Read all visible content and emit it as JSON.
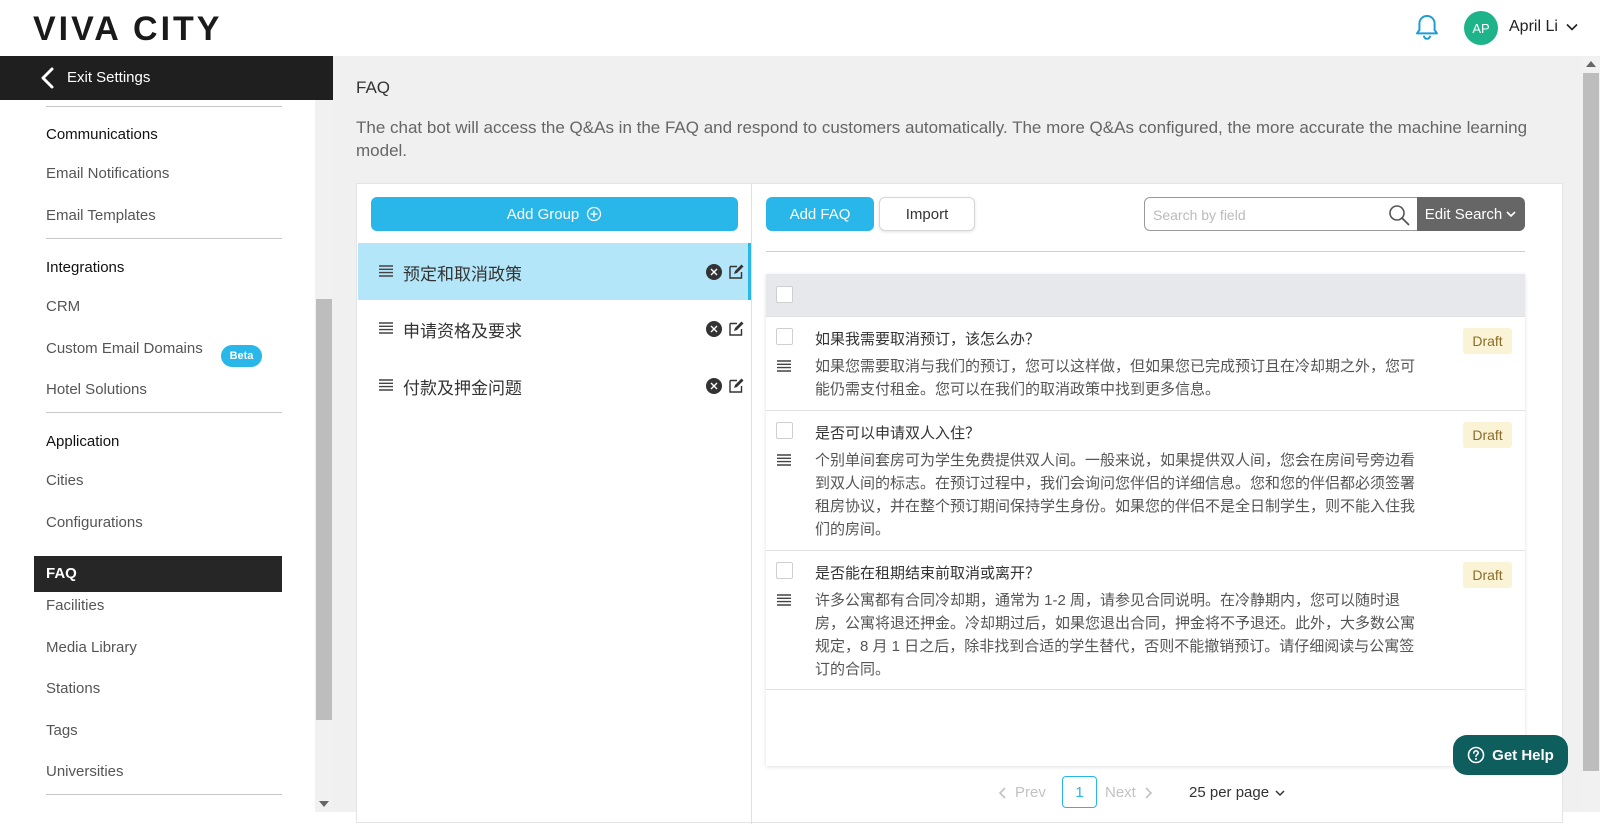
{
  "brand": {
    "logo_text": "VIVA CITY"
  },
  "user": {
    "initials": "AP",
    "name": "April Li",
    "avatar_color": "#1fb38a"
  },
  "sidebar": {
    "exit_label": "Exit Settings",
    "sections": [
      {
        "heading": "Communications",
        "items": [
          "Email Notifications",
          "Email Templates"
        ]
      },
      {
        "heading": "Integrations",
        "items": [
          "CRM",
          "Custom Email Domains",
          "Hotel Solutions"
        ],
        "badge": "Beta"
      },
      {
        "heading": "Application",
        "items": [
          "Cities",
          "Configurations",
          "FAQ",
          "Facilities",
          "Media Library",
          "Stations",
          "Tags",
          "Universities"
        ]
      }
    ],
    "active_item": "FAQ"
  },
  "page": {
    "title": "FAQ",
    "description": "The chat bot will access the Q&As in the FAQ and respond to customers automatically. The more Q&As configured, the more accurate the machine learning model."
  },
  "groups": {
    "add_label": "Add Group",
    "items": [
      {
        "label": "预定和取消政策",
        "active": true
      },
      {
        "label": "申请资格及要求",
        "active": false
      },
      {
        "label": "付款及押金问题",
        "active": false
      }
    ]
  },
  "faq": {
    "add_label": "Add FAQ",
    "import_label": "Import",
    "search_placeholder": "Search by field",
    "edit_search_label": "Edit Search",
    "items": [
      {
        "question": "如果我需要取消预订，该怎么办？",
        "answer": "如果您需要取消与我们的预订，您可以这样做，但如果您已完成预订且在冷却期之外，您可能仍需支付租金。您可以在我们的取消政策中找到更多信息。",
        "status": "Draft"
      },
      {
        "question": "是否可以申请双人入住？",
        "answer": "个别单间套房可为学生免费提供双人间。一般来说，如果提供双人间，您会在房间号旁边看到双人间的标志。在预订过程中，我们会询问您伴侣的详细信息。您和您的伴侣都必须签署租房协议，并在整个预订期间保持学生身份。如果您的伴侣不是全日制学生，则不能入住我们的房间。",
        "status": "Draft"
      },
      {
        "question": "是否能在租期结束前取消或离开？",
        "answer": "许多公寓都有合同冷却期，通常为 1-2 周，请参见合同说明。在冷静期内，您可以随时退房，公寓将退还押金。冷却期过后，如果您退出合同，押金将不予退还。此外，大多数公寓规定，8 月 1 日之后，除非找到合适的学生替代，否则不能撤销预订。请仔细阅读与公寓签订的合同。",
        "status": "Draft"
      }
    ]
  },
  "pagination": {
    "prev": "Prev",
    "current": "1",
    "next": "Next",
    "page_size": "25 per page"
  },
  "help": {
    "label": "Get Help"
  },
  "colors": {
    "accent": "#29b6e8",
    "active_group_bg": "#b3e6f9",
    "help_bg": "#0e5e5e",
    "draft_bg": "#fbf3d5"
  }
}
